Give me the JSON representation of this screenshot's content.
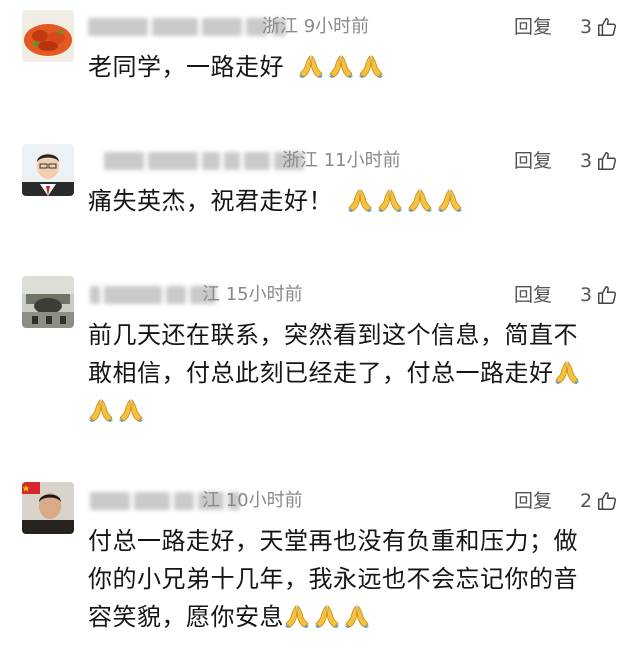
{
  "ui": {
    "reply_label": "回复",
    "pray_icon": "pray-emoji-icon",
    "like_icon": "thumbs-up-icon",
    "accent": "#f2b233"
  },
  "comments": [
    {
      "location": "浙江",
      "time": "9小时前",
      "likes": "3",
      "text": "老同学，一路走好",
      "pray_count": 3
    },
    {
      "location": "浙江",
      "time": "11小时前",
      "likes": "3",
      "text": "痛失英杰，祝君走好！",
      "pray_count": 4
    },
    {
      "location": "江",
      "time": "15小时前",
      "likes": "3",
      "text_line1": "前几天还在联系，突然看到这个信息，简直不",
      "text_line2": "敢相信，付总此刻已经走了，付总一路走好",
      "pray_count": 3
    },
    {
      "location": "江",
      "time": "10小时前",
      "likes": "2",
      "text_line1": "付总一路走好，天堂再也没有负重和压力；做",
      "text_line2": "你的小兄弟十几年，我永远也不会忘记你的音",
      "text_line3": "容笑貌，愿你安息",
      "pray_count": 3
    }
  ]
}
